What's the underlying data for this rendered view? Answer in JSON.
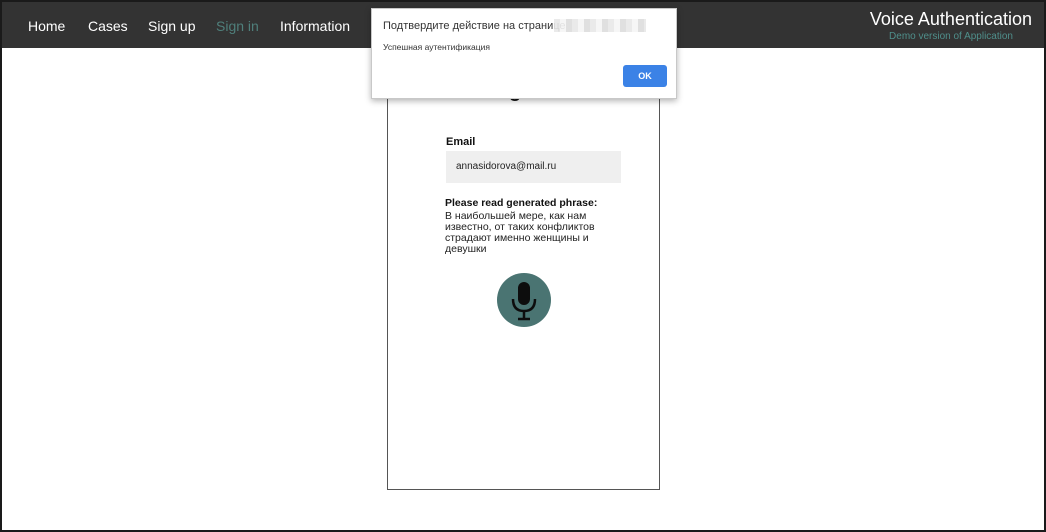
{
  "nav": {
    "items": [
      {
        "label": "Home"
      },
      {
        "label": "Cases"
      },
      {
        "label": "Sign up"
      },
      {
        "label": "Sign in"
      },
      {
        "label": "Information"
      }
    ],
    "active": "Sign in",
    "brand_title": "Voice Authentication",
    "brand_subtitle": "Demo version of Application"
  },
  "card": {
    "title": "Sign in",
    "email_label": "Email",
    "email_value": "annasidorova@mail.ru",
    "phrase_label": "Please read generated phrase:",
    "phrase_text": "В наибольшей мере, как нам известно, от таких конфликтов страдают именно женщины и девушки",
    "mic_icon": "microphone-icon"
  },
  "dialog": {
    "title": "Подтвердите действие на странице",
    "message": "Успешная аутентификация",
    "ok_label": "OK"
  },
  "colors": {
    "navbar_bg": "#333333",
    "active_nav": "#4f7f7b",
    "brand_subtitle": "#4f8f8b",
    "mic_bg": "#4a7472",
    "ok_button": "#3b82e6"
  }
}
